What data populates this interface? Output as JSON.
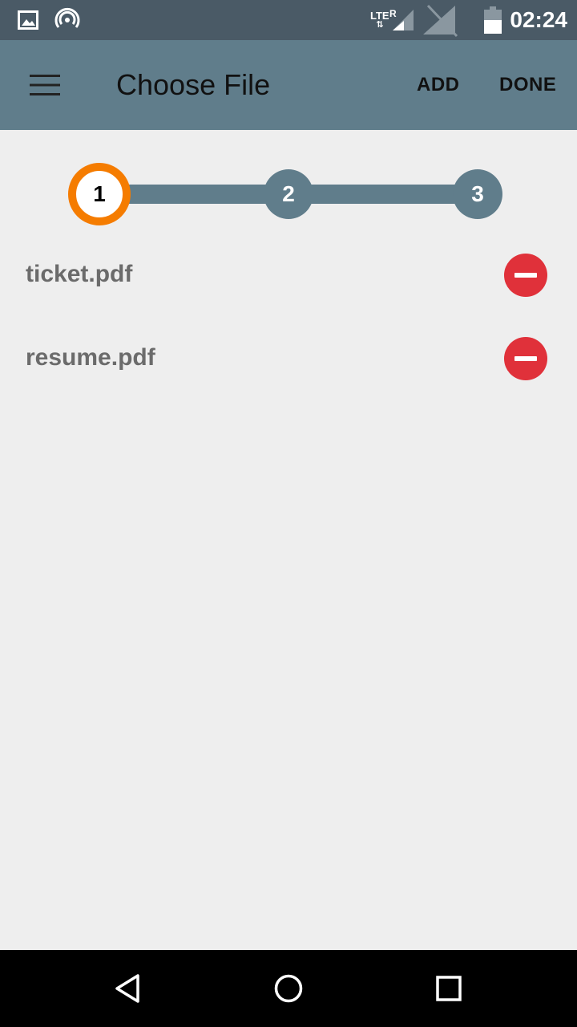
{
  "status_bar": {
    "time": "02:24",
    "network_label": "LTE",
    "roaming_label": "R",
    "icons": [
      "image-icon",
      "hotspot-icon",
      "lte-icon",
      "signal-icon",
      "no-sim-icon",
      "battery-icon"
    ]
  },
  "app_bar": {
    "title": "Choose File",
    "add_label": "ADD",
    "done_label": "DONE"
  },
  "stepper": {
    "steps": [
      "1",
      "2",
      "3"
    ],
    "active_step": 1,
    "active_color": "#f57c00",
    "inactive_color": "#607d8b"
  },
  "files": [
    {
      "name": "ticket.pdf"
    },
    {
      "name": "resume.pdf"
    }
  ],
  "colors": {
    "app_bar": "#607d8b",
    "status_bar": "#4a5a66",
    "remove": "#e0313a",
    "background": "#eeeeee"
  }
}
